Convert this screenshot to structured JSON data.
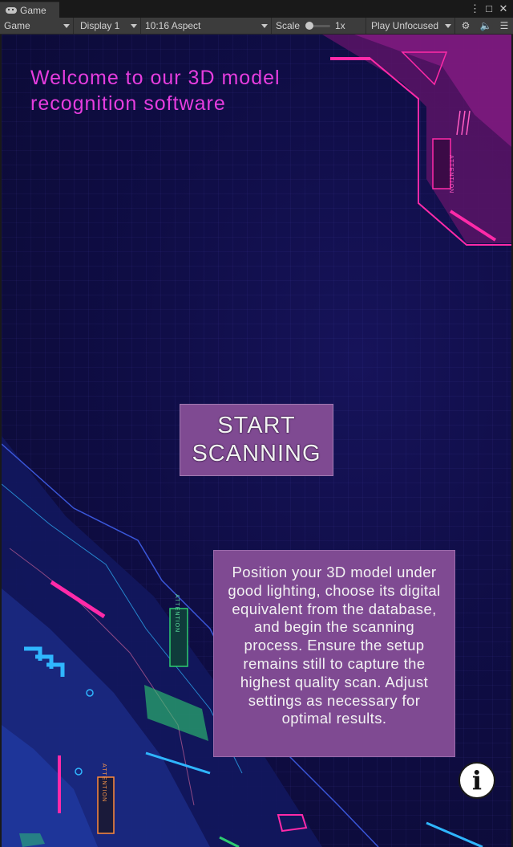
{
  "editor": {
    "tab_title": "Game",
    "tab_icon": "gamepad-icon",
    "window_controls": [
      "kebab-menu-icon",
      "maximize-icon",
      "close-icon"
    ],
    "toolbar": {
      "view_mode": "Game",
      "display": "Display 1",
      "aspect": "10:16 Aspect",
      "scale_label": "Scale",
      "scale_value": "1x",
      "play_mode": "Play Unfocused",
      "icons": [
        "bug-icon",
        "speaker-icon",
        "stats-icon"
      ]
    }
  },
  "game": {
    "welcome": "Welcome to our 3D model recognition software",
    "start_button": "START SCANNING",
    "instructions": "Position your 3D model under good lighting, choose its digital equivalent from the database, and begin the scanning process. Ensure the setup remains still to capture the highest quality scan. Adjust settings as necessary for optimal results.",
    "info_button": "i",
    "deco_label": "ATTENTION",
    "colors": {
      "background": "#0f0d45",
      "accent_magenta": "#e63ddf",
      "button_fill": "#7f4a92",
      "neon_pink": "#ff2aa8",
      "neon_cyan": "#2fb6ff",
      "neon_green": "#2ecc71"
    }
  }
}
